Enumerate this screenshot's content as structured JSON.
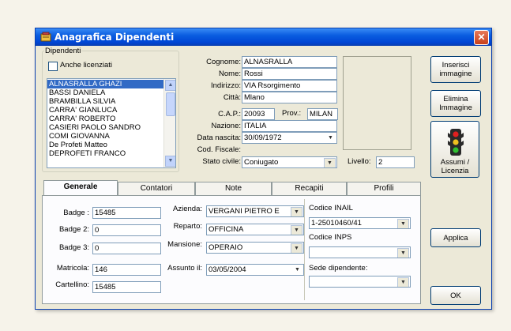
{
  "window": {
    "title": "Anagrafica Dipendenti",
    "close": "✕"
  },
  "dipendenti": {
    "group_label": "Dipendenti",
    "anche_licenziati": "Anche licenziati",
    "items": [
      "ALNASRALLA GHAZI",
      "BASSI DANIELA",
      "BRAMBILLA SILVIA",
      "CARRA' GIANLUCA",
      "CARRA' ROBERTO",
      "CASIERI PAOLO SANDRO",
      "COMI GIOVANNA",
      "De Profeti Matteo",
      "DEPROFETI FRANCO"
    ],
    "selected_index": 0
  },
  "anagrafica": {
    "cognome_label": "Cognome:",
    "cognome": "ALNASRALLA",
    "nome_label": "Nome:",
    "nome": "Rossi",
    "indirizzo_label": "Indirizzo:",
    "indirizzo": "VIA Rsorgimento",
    "citta_label": "Città:",
    "citta": "Mlano",
    "cap_label": "C.A.P.:",
    "cap": "20093",
    "prov_label": "Prov.:",
    "prov": "MILAN",
    "nazione_label": "Nazione:",
    "nazione": "ITALIA",
    "data_nascita_label": "Data nascita:",
    "data_nascita": "30/09/1972",
    "cod_fiscale_label": "Cod. Fiscale:",
    "cod_fiscale": "",
    "stato_civile_label": "Stato civile:",
    "stato_civile": "Coniugato",
    "livello_label": "Livello:",
    "livello": "2"
  },
  "buttons": {
    "inserisci_immagine": "Inserisci immagine",
    "elimina_immagine": "Elimina Immagine",
    "assumi_licenzia": "Assumi / Licenzia",
    "applica": "Applica",
    "ok": "OK"
  },
  "tabs": [
    "Generale",
    "Contatori",
    "Note",
    "Recapiti",
    "Profili"
  ],
  "generale": {
    "badge_label": "Badge :",
    "badge": "15485",
    "badge2_label": "Badge 2:",
    "badge2": "0",
    "badge3_label": "Badge 3:",
    "badge3": "0",
    "matricola_label": "Matricola:",
    "matricola": "146",
    "cartellino_label": "Cartellino:",
    "cartellino": "15485",
    "azienda_label": "Azienda:",
    "azienda": "VERGANI PIETRO E",
    "reparto_label": "Reparto:",
    "reparto": "OFFICINA",
    "mansione_label": "Mansione:",
    "mansione": "OPERAIO",
    "assunto_label": "Assunto il:",
    "assunto": "03/05/2004",
    "codice_inail_label": "Codice INAIL",
    "codice_inail": "1-25010460/41",
    "codice_inps_label": "Codice INPS",
    "codice_inps": "",
    "sede_label": "Sede dipendente:",
    "sede": ""
  },
  "icons": {
    "app": "app-icon",
    "traffic_light": "traffic-light-icon"
  }
}
